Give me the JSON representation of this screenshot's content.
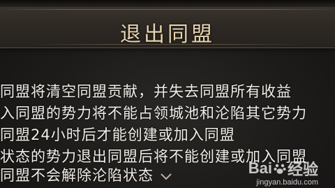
{
  "dialog": {
    "title": "退出同盟",
    "lines": [
      "同盟将清空同盟贡献，并失去同盟所有收益",
      "入同盟的势力将不能占领城池和沦陷其它势力",
      "同盟24小时后才能创建或加入同盟",
      "状态的势力退出同盟后将不能创建或加入同盟",
      "同盟不会解除沦陷状态"
    ],
    "scroll_icon": "chevron-down-icon"
  },
  "watermark": {
    "brand_left": "Bai",
    "brand_right": "经验",
    "url": "jingyan.baidu.com"
  },
  "colors": {
    "title": "#e6d3b0",
    "text": "#f2eee8",
    "background": "#1c1a19"
  }
}
